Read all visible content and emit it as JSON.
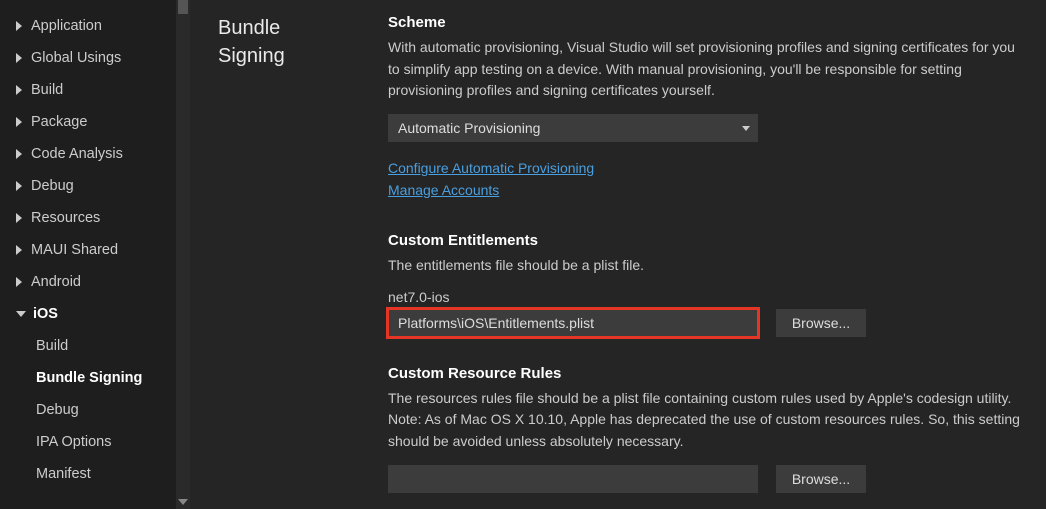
{
  "sidebar": {
    "items": [
      {
        "label": "Application",
        "expanded": false
      },
      {
        "label": "Global Usings",
        "expanded": false
      },
      {
        "label": "Build",
        "expanded": false
      },
      {
        "label": "Package",
        "expanded": false
      },
      {
        "label": "Code Analysis",
        "expanded": false
      },
      {
        "label": "Debug",
        "expanded": false
      },
      {
        "label": "Resources",
        "expanded": false
      },
      {
        "label": "MAUI Shared",
        "expanded": false
      },
      {
        "label": "Android",
        "expanded": false
      },
      {
        "label": "iOS",
        "expanded": true
      }
    ],
    "ios_sub": [
      {
        "label": "Build",
        "active": false
      },
      {
        "label": "Bundle Signing",
        "active": true
      },
      {
        "label": "Debug",
        "active": false
      },
      {
        "label": "IPA Options",
        "active": false
      },
      {
        "label": "Manifest",
        "active": false
      }
    ]
  },
  "section_title": "Bundle Signing",
  "scheme": {
    "heading": "Scheme",
    "description": "With automatic provisioning, Visual Studio will set provisioning profiles and signing certificates for you to simplify app testing on a device. With manual provisioning, you'll be responsible for setting provisioning profiles and signing certificates yourself.",
    "selected": "Automatic Provisioning",
    "link1": "Configure Automatic Provisioning",
    "link2": "Manage Accounts"
  },
  "entitlements": {
    "heading": "Custom Entitlements",
    "description": "The entitlements file should be a plist file.",
    "framework_label": "net7.0-ios",
    "path_value": "Platforms\\iOS\\Entitlements.plist",
    "browse": "Browse..."
  },
  "resource_rules": {
    "heading": "Custom Resource Rules",
    "description": "The resources rules file should be a plist file containing custom rules used by Apple's codesign utility. Note: As of Mac OS X 10.10, Apple has deprecated the use of custom resources rules. So, this setting should be avoided unless absolutely necessary.",
    "path_value": "",
    "browse": "Browse..."
  }
}
